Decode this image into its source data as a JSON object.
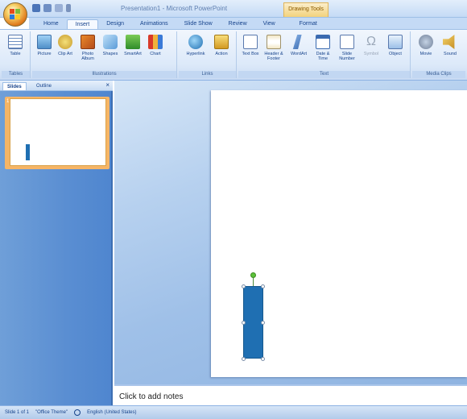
{
  "window": {
    "title": "Presentation1 - Microsoft PowerPoint",
    "contextual_tab_group": "Drawing Tools"
  },
  "tabs": [
    {
      "label": "Home",
      "active": false
    },
    {
      "label": "Insert",
      "active": true
    },
    {
      "label": "Design",
      "active": false
    },
    {
      "label": "Animations",
      "active": false
    },
    {
      "label": "Slide Show",
      "active": false
    },
    {
      "label": "Review",
      "active": false
    },
    {
      "label": "View",
      "active": false
    },
    {
      "label": "Format",
      "active": false
    }
  ],
  "ribbon": {
    "groups": [
      {
        "label": "Tables",
        "commands": [
          "Table"
        ]
      },
      {
        "label": "Illustrations",
        "commands": [
          "Picture",
          "Clip Art",
          "Photo Album",
          "Shapes",
          "SmartArt",
          "Chart"
        ]
      },
      {
        "label": "Links",
        "commands": [
          "Hyperlink",
          "Action"
        ]
      },
      {
        "label": "Text",
        "commands": [
          "Text Box",
          "Header & Footer",
          "WordArt",
          "Date & Time",
          "Slide Number",
          "Symbol",
          "Object"
        ]
      },
      {
        "label": "Media Clips",
        "commands": [
          "Movie",
          "Sound"
        ]
      }
    ]
  },
  "left_pane": {
    "tabs": [
      "Slides",
      "Outline"
    ],
    "close_glyph": "×",
    "slide_number": "1"
  },
  "notes": {
    "placeholder": "Click to add notes"
  },
  "status": {
    "slide_info": "Slide 1 of 1",
    "theme": "\"Office Theme\"",
    "language": "English (United States)"
  },
  "colors": {
    "shape_fill": "#1f6fb2",
    "thumbnail_selection": "#f6b566",
    "ribbon_bg": "#dce9f9"
  }
}
